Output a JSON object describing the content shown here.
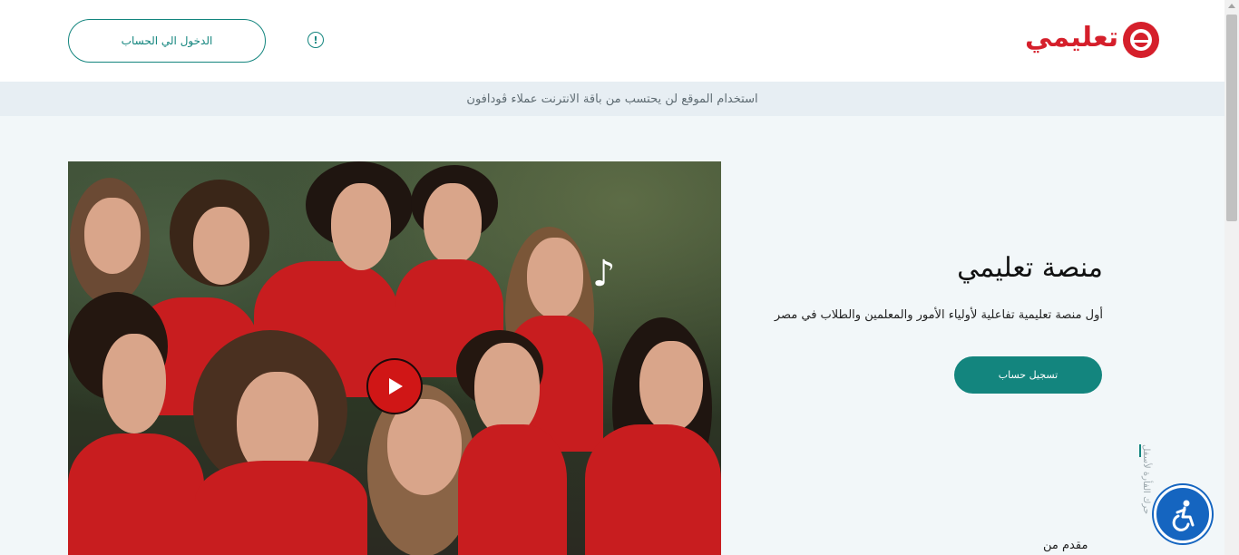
{
  "header": {
    "login_label": "الدخول الي الحساب",
    "info_icon": "!",
    "logo_text": "تعليمي"
  },
  "notice": {
    "text": "استخدام الموقع لن يحتسب من باقة الانترنت عملاء ڤودافون"
  },
  "hero": {
    "title": "منصة تعليمي",
    "subtitle": "أول منصة تعليمية تفاعلية لأولياء الأمور والمعلمين والطلاب في مصر",
    "signup_label": "تسجيل حساب",
    "scroll_hint": "حرك الفأرة لأسفل",
    "provided_by": "مقدم من"
  },
  "video": {
    "play_icon": "play-icon"
  },
  "colors": {
    "brand_red": "#d51f2b",
    "accent_teal": "#13857e",
    "notice_bg": "#e7eef3",
    "page_bg": "#f2f7f9",
    "accessibility_blue": "#1565c0"
  }
}
